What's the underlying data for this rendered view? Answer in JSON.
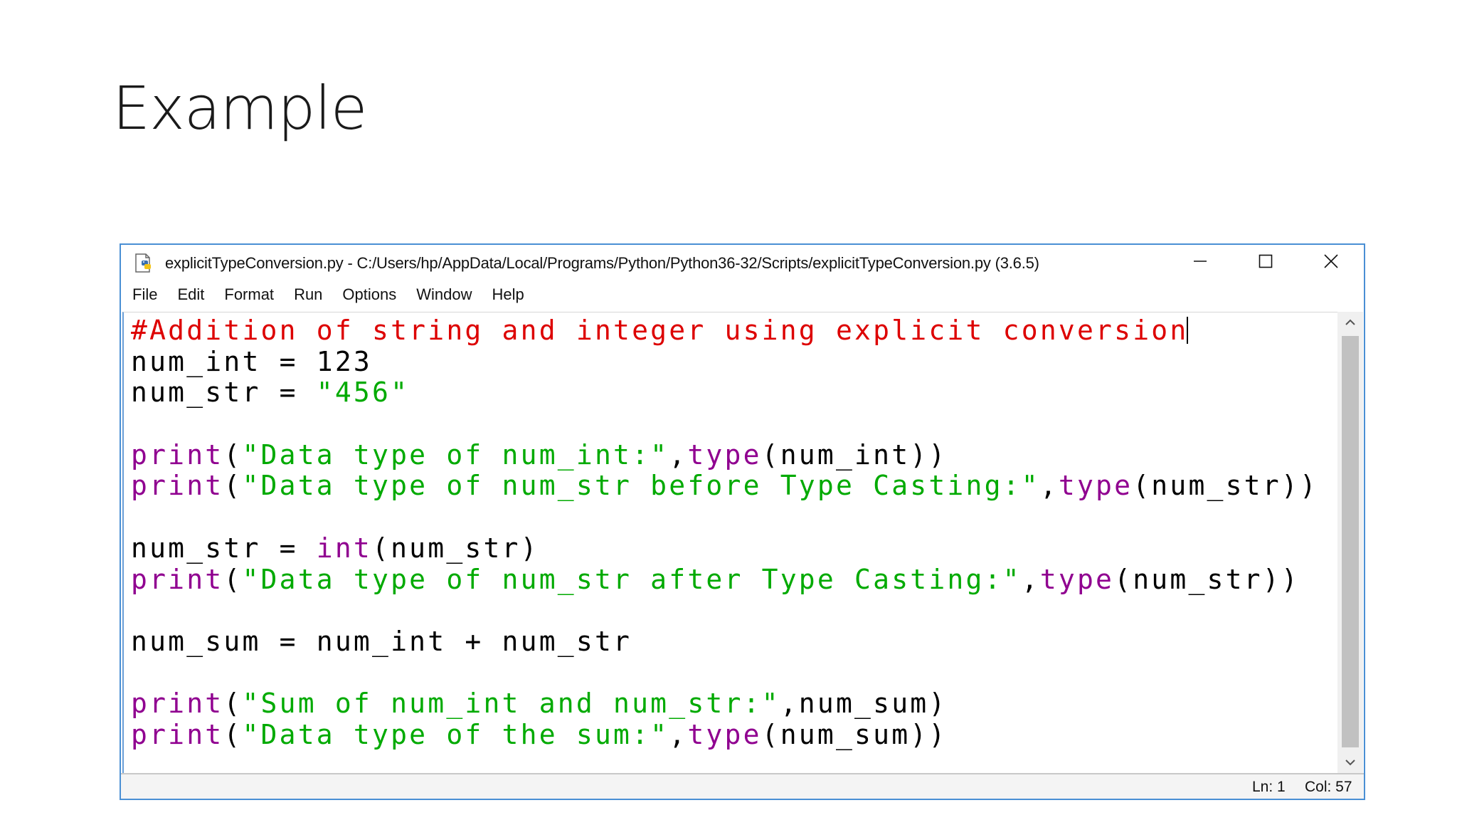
{
  "slide": {
    "title": "Example"
  },
  "window": {
    "title": "explicitTypeConversion.py - C:/Users/hp/AppData/Local/Programs/Python/Python36-32/Scripts/explicitTypeConversion.py (3.6.5)",
    "icon": "python-file-icon"
  },
  "menu": {
    "items": [
      "File",
      "Edit",
      "Format",
      "Run",
      "Options",
      "Window",
      "Help"
    ]
  },
  "editor": {
    "lines": [
      [
        {
          "t": "#Addition of string and integer using explicit conversion",
          "k": "comment"
        }
      ],
      [
        {
          "t": "num_int = 123",
          "k": "plain"
        }
      ],
      [
        {
          "t": "num_str = ",
          "k": "plain"
        },
        {
          "t": "\"456\"",
          "k": "string"
        }
      ],
      [],
      [
        {
          "t": "print",
          "k": "builtin"
        },
        {
          "t": "(",
          "k": "plain"
        },
        {
          "t": "\"Data type of num_int:\"",
          "k": "string"
        },
        {
          "t": ",",
          "k": "plain"
        },
        {
          "t": "type",
          "k": "builtin"
        },
        {
          "t": "(num_int))",
          "k": "plain"
        }
      ],
      [
        {
          "t": "print",
          "k": "builtin"
        },
        {
          "t": "(",
          "k": "plain"
        },
        {
          "t": "\"Data type of num_str before Type Casting:\"",
          "k": "string"
        },
        {
          "t": ",",
          "k": "plain"
        },
        {
          "t": "type",
          "k": "builtin"
        },
        {
          "t": "(num_str))",
          "k": "plain"
        }
      ],
      [],
      [
        {
          "t": "num_str = ",
          "k": "plain"
        },
        {
          "t": "int",
          "k": "builtin"
        },
        {
          "t": "(num_str)",
          "k": "plain"
        }
      ],
      [
        {
          "t": "print",
          "k": "builtin"
        },
        {
          "t": "(",
          "k": "plain"
        },
        {
          "t": "\"Data type of num_str after Type Casting:\"",
          "k": "string"
        },
        {
          "t": ",",
          "k": "plain"
        },
        {
          "t": "type",
          "k": "builtin"
        },
        {
          "t": "(num_str))",
          "k": "plain"
        }
      ],
      [],
      [
        {
          "t": "num_sum = num_int + num_str",
          "k": "plain"
        }
      ],
      [],
      [
        {
          "t": "print",
          "k": "builtin"
        },
        {
          "t": "(",
          "k": "plain"
        },
        {
          "t": "\"Sum of num_int and num_str:\"",
          "k": "string"
        },
        {
          "t": ",num_sum)",
          "k": "plain"
        }
      ],
      [
        {
          "t": "print",
          "k": "builtin"
        },
        {
          "t": "(",
          "k": "plain"
        },
        {
          "t": "\"Data type of the sum:\"",
          "k": "string"
        },
        {
          "t": ",",
          "k": "plain"
        },
        {
          "t": "type",
          "k": "builtin"
        },
        {
          "t": "(num_sum))",
          "k": "plain"
        }
      ]
    ],
    "caret_line": 0
  },
  "status": {
    "ln": "Ln: 1",
    "col": "Col: 57"
  },
  "colors": {
    "comment": "#dd0000",
    "builtin": "#900090",
    "string": "#00aa00",
    "window_border": "#4a8fd4"
  }
}
